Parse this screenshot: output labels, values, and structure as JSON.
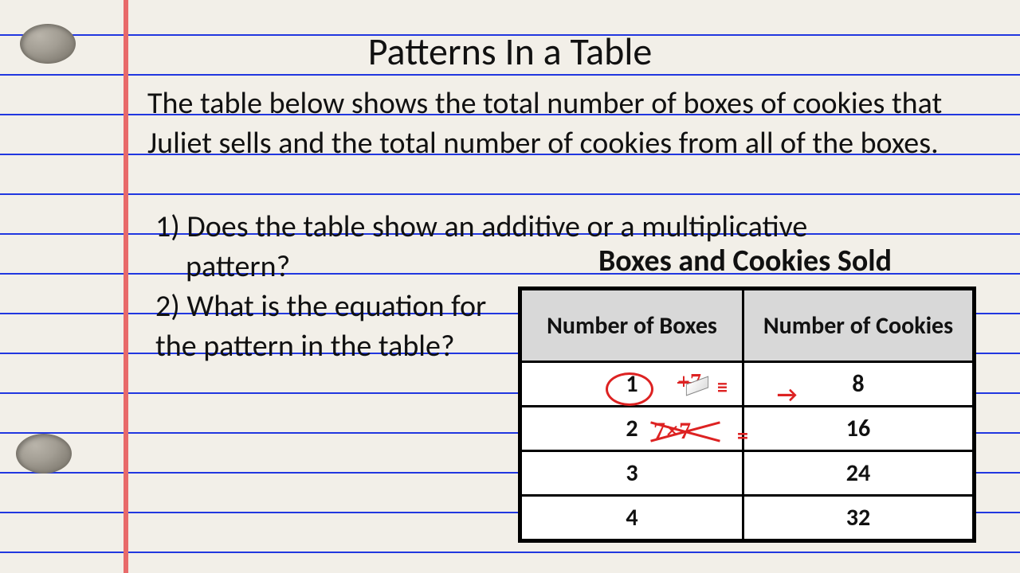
{
  "title": "Patterns In a Table",
  "intro": "The table below shows the total number of boxes of cookies that Juliet sells and the total number of cookies from all of the boxes.",
  "q1_num": "1)",
  "q1_line1": "Does the table show an additive or a multiplicative",
  "q1_line2": "pattern?",
  "q2_num": "2)",
  "q2_text": "What is the equation for the pattern in the table?",
  "table_title": "Boxes and Cookies Sold",
  "headers": {
    "boxes": "Number of Boxes",
    "cookies": "Number of Cookies"
  },
  "rows": [
    {
      "boxes": "1",
      "cookies": "8"
    },
    {
      "boxes": "2",
      "cookies": "16"
    },
    {
      "boxes": "3",
      "cookies": "24"
    },
    {
      "boxes": "4",
      "cookies": "32"
    }
  ],
  "annotations": {
    "plus7": "+7",
    "triple_eq": "≡",
    "arrow": "→",
    "cross7": "7×7",
    "eq2": "="
  }
}
